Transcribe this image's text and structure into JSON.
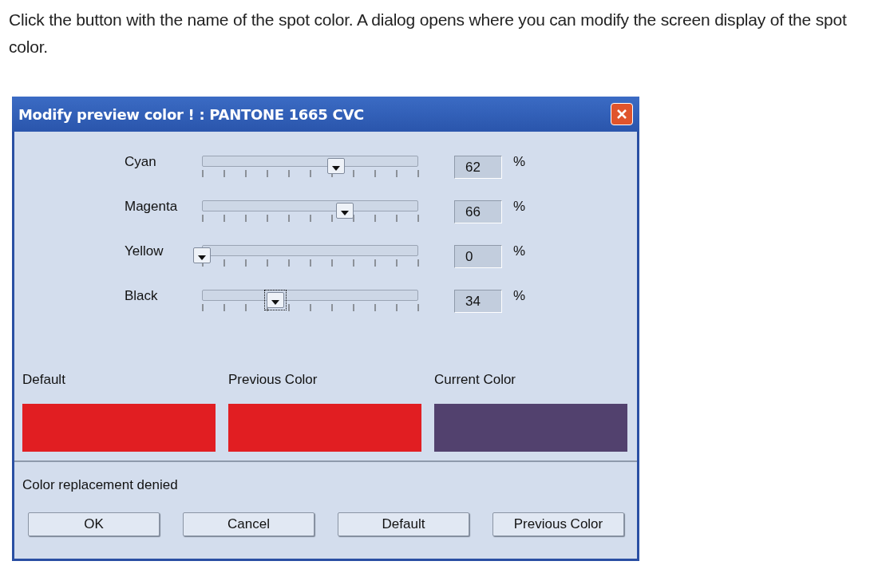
{
  "instruction": "Click the button with the name of the spot color. A dialog opens where you can modify the screen display of the spot color.",
  "dialog": {
    "title": "Modify preview color ! : PANTONE 1665 CVC",
    "channels": [
      {
        "name": "Cyan",
        "level": 0.62,
        "value": "62",
        "unit": "%",
        "focused": false
      },
      {
        "name": "Magenta",
        "level": 0.66,
        "value": "66",
        "unit": "%",
        "focused": false
      },
      {
        "name": "Yellow",
        "level": 0,
        "value": "0",
        "unit": "%",
        "focused": false
      },
      {
        "name": "Black",
        "level": 0.34,
        "value": "34",
        "unit": "%",
        "focused": true
      }
    ],
    "swatches": [
      {
        "label": "Default",
        "color": "#e11e22"
      },
      {
        "label": "Previous Color",
        "color": "#e11e22"
      },
      {
        "label": "Current Color",
        "color": "#52416e"
      }
    ],
    "status": "Color replacement denied",
    "buttons": [
      "OK",
      "Cancel",
      "Default",
      "Previous Color"
    ]
  }
}
